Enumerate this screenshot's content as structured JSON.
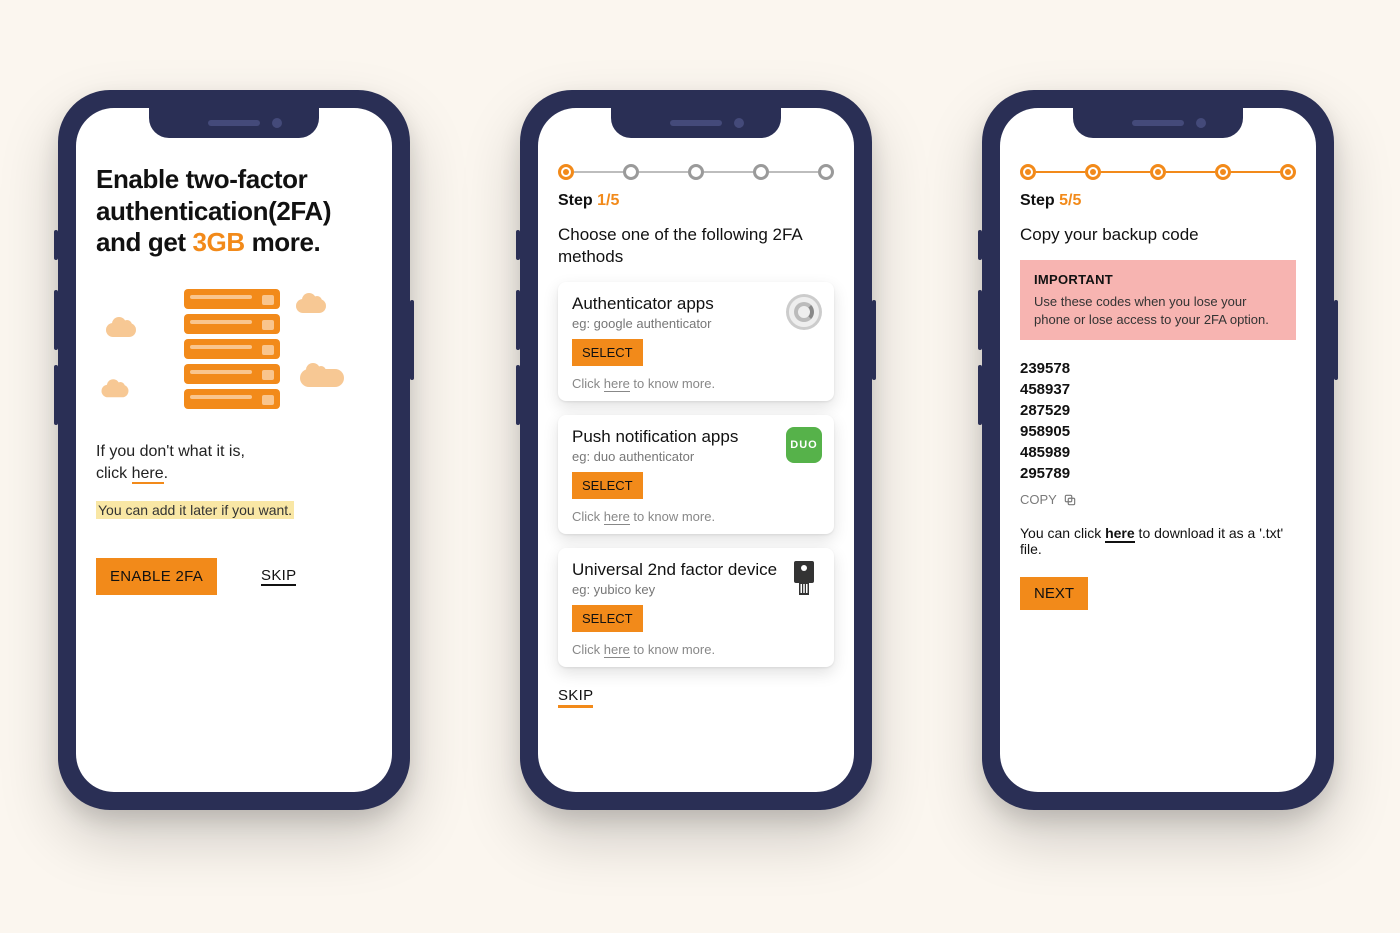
{
  "phone1": {
    "title_line1": "Enable two-factor",
    "title_line2": "authentication(2FA)",
    "title_line3a": "and get ",
    "title_accent": "3GB",
    "title_line3b": " more.",
    "subtext_pre": "If you don't what it is,",
    "subtext_click": "click ",
    "subtext_here": "here",
    "subtext_dot": ".",
    "note": "You can add it later if you want.",
    "enable_btn": "ENABLE 2FA",
    "skip": "SKIP"
  },
  "phone2": {
    "step_word": "Step ",
    "step_num": "1/5",
    "prompt": "Choose one of the following 2FA methods",
    "cards": [
      {
        "title": "Authenticator apps",
        "sub": "eg: google authenticator",
        "select": "SELECT",
        "footer_pre": "Click ",
        "footer_here": "here",
        "footer_post": " to know more."
      },
      {
        "title": "Push notification apps",
        "sub": "eg: duo authenticator",
        "select": "SELECT",
        "footer_pre": "Click ",
        "footer_here": "here",
        "footer_post": " to know more."
      },
      {
        "title": "Universal 2nd factor device",
        "sub": "eg: yubico key",
        "select": "SELECT",
        "footer_pre": "Click ",
        "footer_here": "here",
        "footer_post": " to know more."
      }
    ],
    "skip": "SKIP"
  },
  "phone3": {
    "step_word": "Step ",
    "step_num": "5/5",
    "prompt": "Copy your backup code",
    "important_head": "IMPORTANT",
    "important_body": "Use these codes when you lose your phone or lose access to your 2FA option.",
    "codes": [
      "239578",
      "458937",
      "287529",
      "958905",
      "485989",
      "295789"
    ],
    "copy": "COPY",
    "download_pre": "You can click ",
    "download_here": "here",
    "download_post": " to download it as a '.txt' file.",
    "next": "NEXT"
  }
}
